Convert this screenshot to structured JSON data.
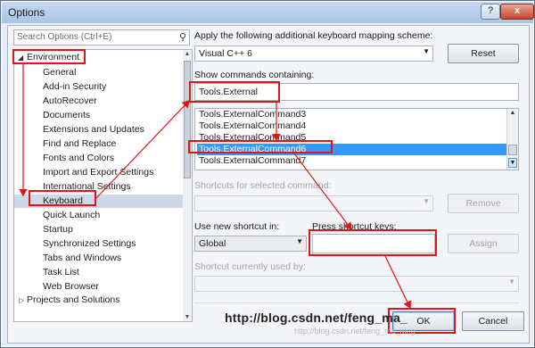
{
  "window": {
    "title": "Options",
    "help_label": "?",
    "close_label": "x"
  },
  "search": {
    "placeholder": "Search Options (Ctrl+E)"
  },
  "tree": {
    "root": "Environment",
    "items": [
      "General",
      "Add-in Security",
      "AutoRecover",
      "Documents",
      "Extensions and Updates",
      "Find and Replace",
      "Fonts and Colors",
      "Import and Export Settings",
      "International Settings",
      "Keyboard",
      "Quick Launch",
      "Startup",
      "Synchronized Settings",
      "Tabs and Windows",
      "Task List",
      "Web Browser"
    ],
    "next_root": "Projects and Solutions",
    "selected": "Keyboard"
  },
  "mapping": {
    "label": "Apply the following additional keyboard mapping scheme:",
    "value": "Visual C++ 6",
    "reset_label": "Reset"
  },
  "commands": {
    "label": "Show commands containing:",
    "filter_value": "Tools.External",
    "items": [
      "Tools.ExternalCommand3",
      "Tools.ExternalCommand4",
      "Tools.ExternalCommand5",
      "Tools.ExternalCommand6",
      "Tools.ExternalCommand7"
    ],
    "selected": "Tools.ExternalCommand6"
  },
  "shortcuts": {
    "label": "Shortcuts for selected command:",
    "remove_label": "Remove"
  },
  "new_shortcut": {
    "label": "Use new shortcut in:",
    "value": "Global",
    "press_label": "Press shortcut keys:",
    "press_value": "",
    "assign_label": "Assign"
  },
  "used_by": {
    "label": "Shortcut currently used by:"
  },
  "footer": {
    "ok_label": "OK",
    "cancel_label": "Cancel"
  },
  "watermark": {
    "url": "http://blog.csdn.net/feng_ma_",
    "faint": "http://blog.csdn.net/feng_ma_ning"
  },
  "colors": {
    "annotation": "#e01515",
    "selection": "#3399ff"
  }
}
